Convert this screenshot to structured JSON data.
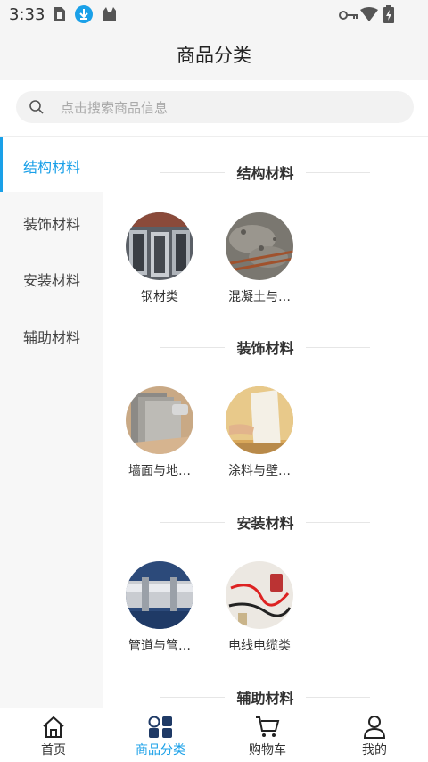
{
  "status": {
    "time": "3:33"
  },
  "header": {
    "title": "商品分类"
  },
  "search": {
    "placeholder": "点击搜索商品信息"
  },
  "sidebar": {
    "items": [
      {
        "label": "结构材料",
        "active": true
      },
      {
        "label": "装饰材料",
        "active": false
      },
      {
        "label": "安装材料",
        "active": false
      },
      {
        "label": "辅助材料",
        "active": false
      }
    ]
  },
  "sections": [
    {
      "title": "结构材料",
      "items": [
        {
          "name": "钢材类"
        },
        {
          "name": "混凝土与…"
        }
      ]
    },
    {
      "title": "装饰材料",
      "items": [
        {
          "name": "墙面与地…"
        },
        {
          "name": "涂料与壁…"
        }
      ]
    },
    {
      "title": "安装材料",
      "items": [
        {
          "name": "管道与管…"
        },
        {
          "name": "电线电缆类"
        }
      ]
    },
    {
      "title": "辅助材料",
      "items": []
    }
  ],
  "tabbar": {
    "items": [
      {
        "label": "首页",
        "icon": "home-icon",
        "active": false
      },
      {
        "label": "商品分类",
        "icon": "category-icon",
        "active": true
      },
      {
        "label": "购物车",
        "icon": "cart-icon",
        "active": false
      },
      {
        "label": "我的",
        "icon": "user-icon",
        "active": false
      }
    ]
  },
  "colors": {
    "accent": "#1aa0e8"
  }
}
